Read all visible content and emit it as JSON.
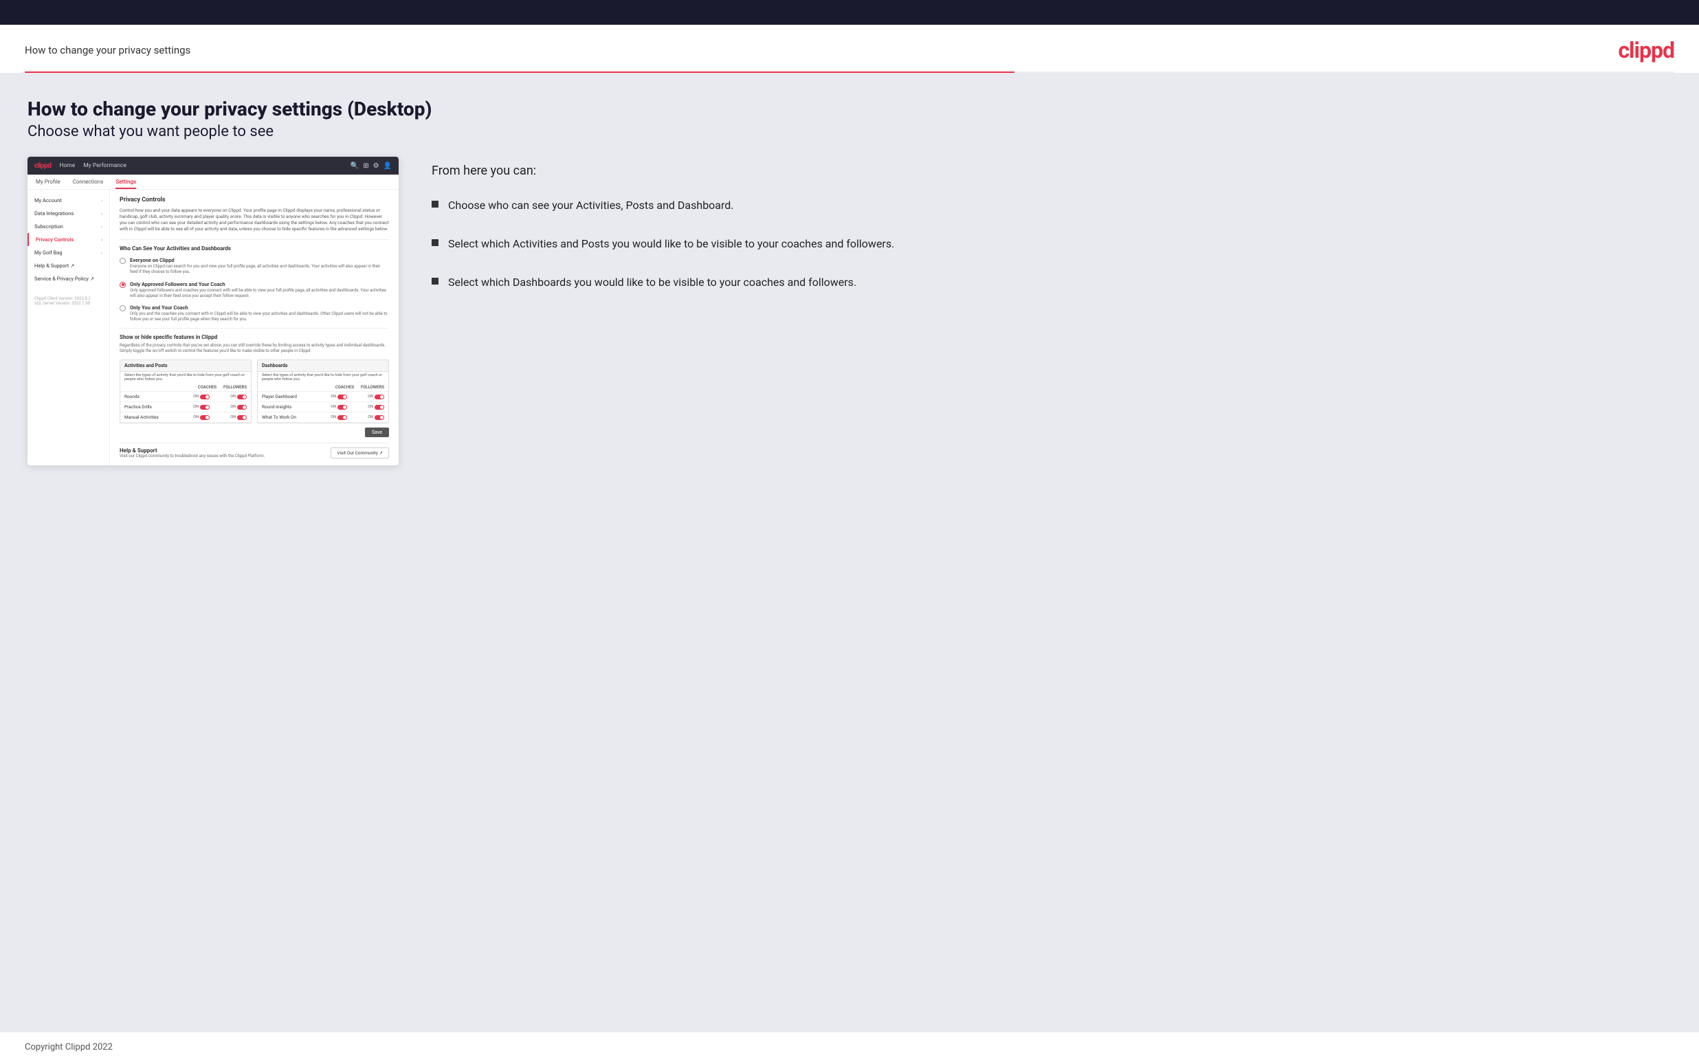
{
  "topBar": {},
  "header": {
    "title": "How to change your privacy settings",
    "logo": "clippd"
  },
  "page": {
    "heading": "How to change your privacy settings (Desktop)",
    "subheading": "Choose what you want people to see"
  },
  "mockup": {
    "nav": {
      "logo": "clippd",
      "links": [
        "Home",
        "My Performance"
      ],
      "icons": [
        "🔍",
        "⊞",
        "⚙",
        "👤"
      ]
    },
    "subnav": [
      "My Profile",
      "Connections",
      "Settings"
    ],
    "activeSubnav": "Settings",
    "sidebar": {
      "items": [
        {
          "label": "My Account",
          "active": false
        },
        {
          "label": "Data Integrations",
          "active": false
        },
        {
          "label": "Subscription",
          "active": false
        },
        {
          "label": "Privacy Controls",
          "active": true
        },
        {
          "label": "My Golf Bag",
          "active": false
        },
        {
          "label": "Help & Support ↗",
          "active": false
        },
        {
          "label": "Service & Privacy Policy ↗",
          "active": false
        }
      ],
      "version": "Clippd Client Version: 2022.8.2\nSQL Server Version: 2022.7.38"
    },
    "content": {
      "sectionTitle": "Privacy Controls",
      "sectionDesc": "Control how you and your data appears to everyone on Clippd. Your profile page in Clippd displays your name, professional status or handicap, golf club, activity summary and player quality score. This data is visible to anyone who searches for you in Clippd. However you can control who can see your detailed activity and performance dashboards using the settings below. Any coaches that you connect with in Clippd will be able to see all of your activity and data, unless you choose to hide specific features in the advanced settings below.",
      "whoTitle": "Who Can See Your Activities and Dashboards",
      "radioOptions": [
        {
          "label": "Everyone on Clippd",
          "desc": "Everyone on Clippd can search for you and view your full profile page, all activities and dashboards. Your activities will also appear in their feed if they choose to follow you.",
          "selected": false
        },
        {
          "label": "Only Approved Followers and Your Coach",
          "desc": "Only approved followers and coaches you connect with will be able to view your full profile page, all activities and dashboards. Your activities will also appear in their feed once you accept their follow request.",
          "selected": true
        },
        {
          "label": "Only You and Your Coach",
          "desc": "Only you and the coaches you connect with in Clippd will be able to view your activities and dashboards. Other Clippd users will not be able to follow you or see your full profile page when they search for you.",
          "selected": false
        }
      ],
      "showTitle": "Show or hide specific features in Clippd",
      "showDesc": "Regardless of the privacy controls that you've set above, you can still override these by limiting access to activity types and individual dashboards. Simply toggle the on/off switch to control the features you'd like to make visible to other people in Clippd.",
      "activitiesTable": {
        "title": "Activities and Posts",
        "desc": "Select the types of activity that you'd like to hide from your golf coach or people who follow you.",
        "headers": [
          "COACHES",
          "FOLLOWERS"
        ],
        "rows": [
          {
            "label": "Rounds",
            "coachVal": "ON",
            "followerVal": "ON"
          },
          {
            "label": "Practice Drills",
            "coachVal": "ON",
            "followerVal": "ON"
          },
          {
            "label": "Manual Activities",
            "coachVal": "ON",
            "followerVal": "ON"
          }
        ]
      },
      "dashboardsTable": {
        "title": "Dashboards",
        "desc": "Select the types of activity that you'd like to hide from your golf coach or people who follow you.",
        "headers": [
          "COACHES",
          "FOLLOWERS"
        ],
        "rows": [
          {
            "label": "Player Dashboard",
            "coachVal": "ON",
            "followerVal": "ON"
          },
          {
            "label": "Round Insights",
            "coachVal": "ON",
            "followerVal": "ON"
          },
          {
            "label": "What To Work On",
            "coachVal": "ON",
            "followerVal": "ON"
          }
        ]
      },
      "saveButton": "Save",
      "helpSection": {
        "title": "Help & Support",
        "desc": "Visit our Clippd community to troubleshoot any issues with the Clippd Platform.",
        "button": "Visit Our Community ↗"
      }
    }
  },
  "bullets": {
    "intro": "From here you can:",
    "items": [
      "Choose who can see your Activities, Posts and Dashboard.",
      "Select which Activities and Posts you would like to be visible to your coaches and followers.",
      "Select which Dashboards you would like to be visible to your coaches and followers."
    ]
  },
  "footer": {
    "copyright": "Copyright Clippd 2022"
  }
}
